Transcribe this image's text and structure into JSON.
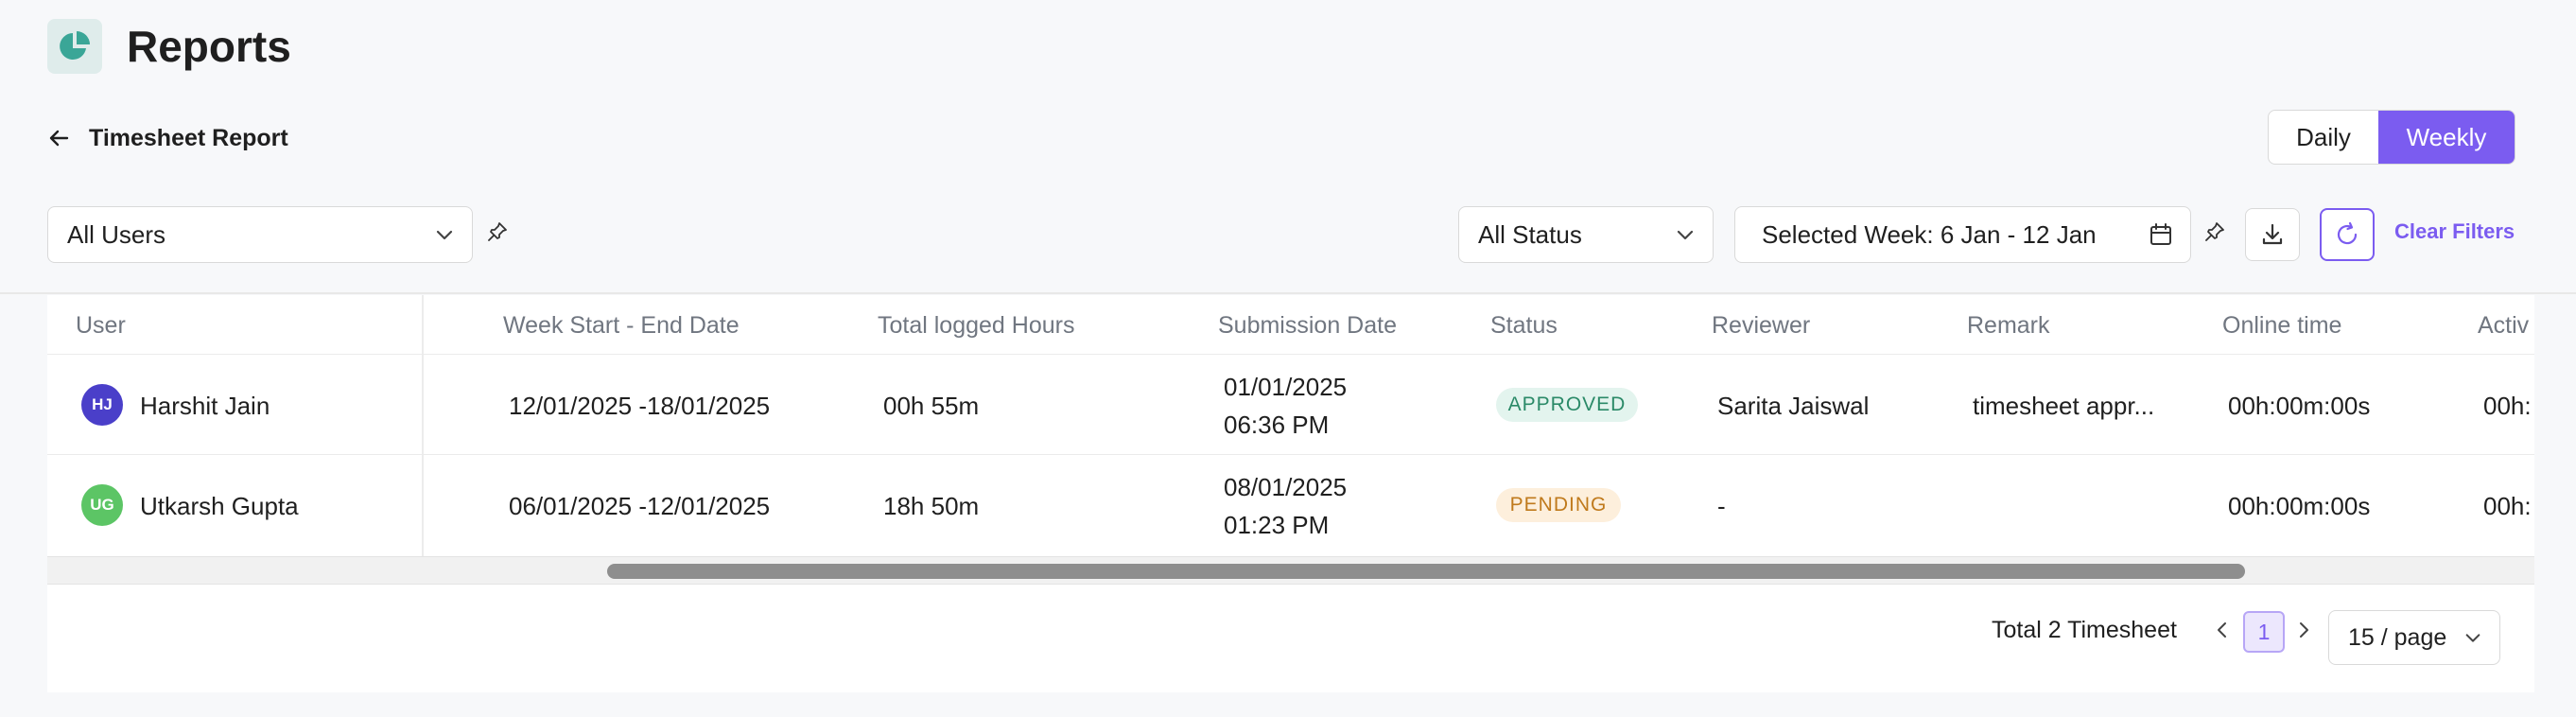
{
  "header": {
    "title": "Reports",
    "logo_icon": "pie-chart-icon",
    "brand_color": "#3aa697"
  },
  "back": {
    "label": "Timesheet Report",
    "icon": "arrow-left-icon"
  },
  "view_toggle": {
    "options": [
      "Daily",
      "Weekly"
    ],
    "selected": "Weekly",
    "accent": "#7b5cf0"
  },
  "filters": {
    "users": "All Users",
    "status": "All Status",
    "week": "Selected Week: 6 Jan - 12 Jan",
    "clear_label": "Clear Filters"
  },
  "table": {
    "columns": [
      "User",
      "Week Start - End Date",
      "Total logged Hours",
      "Submission Date",
      "Status",
      "Reviewer",
      "Remark",
      "Online time",
      "Activ"
    ],
    "rows": [
      {
        "initials": "HJ",
        "avatar_color": "#4a3fc9",
        "user": "Harshit Jain",
        "week": "12/01/2025 -18/01/2025",
        "hours": "00h 55m",
        "sub_date": "01/01/2025",
        "sub_time": "06:36 PM",
        "status": "APPROVED",
        "reviewer": "Sarita Jaiswal",
        "remark": "timesheet appr...",
        "online": "00h:00m:00s",
        "activ": "00h:"
      },
      {
        "initials": "UG",
        "avatar_color": "#5cc565",
        "user": "Utkarsh Gupta",
        "week": "06/01/2025 -12/01/2025",
        "hours": "18h 50m",
        "sub_date": "08/01/2025",
        "sub_time": "01:23 PM",
        "status": "PENDING",
        "reviewer": "-",
        "remark": "",
        "online": "00h:00m:00s",
        "activ": "00h:"
      }
    ]
  },
  "pagination": {
    "total_label": "Total 2 Timesheet",
    "current_page": "1",
    "page_size": "15 / page"
  }
}
